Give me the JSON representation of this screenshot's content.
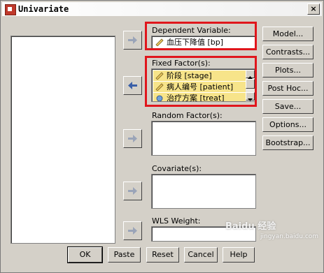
{
  "window": {
    "title": "Univariate",
    "close_label": "×"
  },
  "sections": {
    "dependent": {
      "label": "Dependent Variable:",
      "items": [
        "血压下降值 [bp]"
      ]
    },
    "fixed": {
      "label": "Fixed Factor(s):",
      "items": [
        "阶段 [stage]",
        "病人编号 [patient]",
        "治疗方案 [treat]"
      ]
    },
    "random": {
      "label": "Random Factor(s):"
    },
    "covariate": {
      "label": "Covariate(s):"
    },
    "wls": {
      "label": "WLS Weight:"
    }
  },
  "side_buttons": [
    "Model...",
    "Contrasts...",
    "Plots...",
    "Post Hoc...",
    "Save...",
    "Options...",
    "Bootstrap..."
  ],
  "bottom_buttons": [
    "OK",
    "Paste",
    "Reset",
    "Cancel",
    "Help"
  ],
  "watermark": {
    "text": "Baidu 经验",
    "url": "jingyan.baidu.com"
  },
  "colors": {
    "highlight_box": "#e0161c",
    "selected_item": "#f7e48a",
    "arrow_blue": "#3a5fa8"
  },
  "icons": {
    "move_arrow": "right-arrow-icon",
    "variable": "ruler-icon"
  }
}
